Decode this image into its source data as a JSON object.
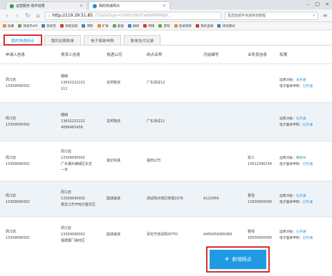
{
  "browser": {
    "tabs": [
      {
        "title": "运营服务-收件结果",
        "active": false
      },
      {
        "title": "我的快递网点",
        "active": true
      }
    ],
    "url_host": "http://119.29.51.85",
    "url_path": "/?DataSign=OWEmNOYwNWRMNJ9...",
    "search_text": "嘉宾能顺丰快速简单教程",
    "bookmarks": [
      "收藏",
      "快递鸟API",
      "快递宝",
      "快速追踪",
      "博客",
      "扩展",
      "截图",
      "翻译",
      "网银",
      "游戏",
      "登录管家",
      "我的直播",
      "阅读模式"
    ]
  },
  "subtabs": [
    "我的快递网点",
    "我的运费账单",
    "电子面单申购",
    "账单支付记录"
  ],
  "columns": [
    "申请人信息",
    "寄货人信息",
    "快递公司",
    "网点名称",
    "月结编号",
    "业务员信息",
    "权限"
  ],
  "rows": [
    {
      "applicant": [
        "周江岩",
        "13309090002"
      ],
      "sender": [
        "珊瑚",
        "13632222222",
        "111"
      ],
      "courier": "龙邦物流",
      "branch": "广东测试12",
      "monthly": "",
      "sales": [],
      "perm1_label": "运费对账：",
      "perm1_value": "未开通",
      "perm1_green": false,
      "perm2_label": "电子面单申购：",
      "perm2_value": "已开通"
    },
    {
      "applicant": [
        "周江岩",
        "13309090002"
      ],
      "sender": [
        "珊瑚",
        "13632222222",
        "4896465456"
      ],
      "courier": "龙邦物流",
      "branch": "广东测试12",
      "monthly": "",
      "sales": [],
      "perm1_label": "运费对账：",
      "perm1_value": "已开通",
      "perm1_green": false,
      "perm2_label": "电子面单申购：",
      "perm2_value": "已开通"
    },
    {
      "applicant": [
        "周江岩",
        "13309090002"
      ],
      "sender": [
        "周江岩",
        "13309090002",
        "广东潮州潮城区东定",
        "一号"
      ],
      "courier": "速达快递",
      "branch": "福田公司",
      "monthly": "",
      "sales": [
        "张三",
        "13512340234"
      ],
      "perm1_label": "运费对账：",
      "perm1_value": "审核中",
      "perm1_green": true,
      "perm2_label": "电子面单申购：",
      "perm2_value": "已开通"
    },
    {
      "applicant": [
        "周江岩",
        "13309090002"
      ],
      "sender": [
        "周江岩",
        "13309090002",
        "惠龙江齐齐哈尔建华区"
      ],
      "courier": "圆通速递",
      "branch": "测试网点地区修理1978",
      "monthly": "A123456",
      "sales": [
        "曹强",
        "13500000000"
      ],
      "perm1_label": "运费对账：",
      "perm1_value": "已开通",
      "perm1_green": false,
      "perm2_label": "电子面单申购：",
      "perm2_value": "已开通"
    },
    {
      "applicant": [
        "周江岩",
        "13309090002"
      ],
      "sender": [
        "周江岩",
        "13309090002",
        "福建厦门海沧区"
      ],
      "courier": "圆通速递",
      "branch": "百花开测试网点YTO",
      "monthly": "A456456465465",
      "sales": [
        "曹强",
        "18500000000"
      ],
      "perm1_label": "运费对账：",
      "perm1_value": "已开通",
      "perm1_green": false,
      "perm2_label": "电子面单申购：",
      "perm2_value": "已开通"
    }
  ],
  "add_button": {
    "label": "新增网点"
  },
  "colors": {
    "accent": "#1e9be3",
    "highlight": "#d62a2a",
    "link": "#1f8fe0",
    "pending": "#2aa04a"
  }
}
